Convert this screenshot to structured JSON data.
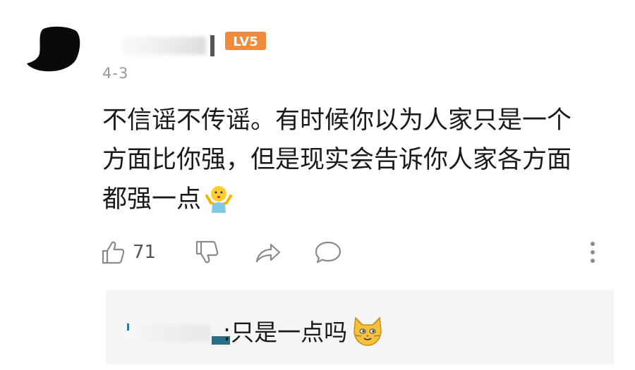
{
  "comment": {
    "level_badge": "LV5",
    "date": "4-3",
    "text_lines": [
      "不信谣不传谣。有时候你以为人家只是一个",
      "方面比你强，但是现实会告诉你人家各方面",
      "都强一点"
    ],
    "inline_emoji": "shrug-emoji-icon",
    "actions": {
      "like_icon": "thumbs-up-icon",
      "like_count": "71",
      "dislike_icon": "thumbs-down-icon",
      "share_icon": "share-arrow-icon",
      "reply_icon": "speech-bubble-icon",
      "more_icon": "more-vertical-icon"
    }
  },
  "reply": {
    "separator": ":",
    "text": "只是一点吗",
    "emoji": "cat-face-emoji-icon"
  },
  "colors": {
    "level_badge": "#f08a3c",
    "icon_gray": "#8a8a8a",
    "date_gray": "#999999",
    "reply_bg": "#f5f5f5"
  }
}
